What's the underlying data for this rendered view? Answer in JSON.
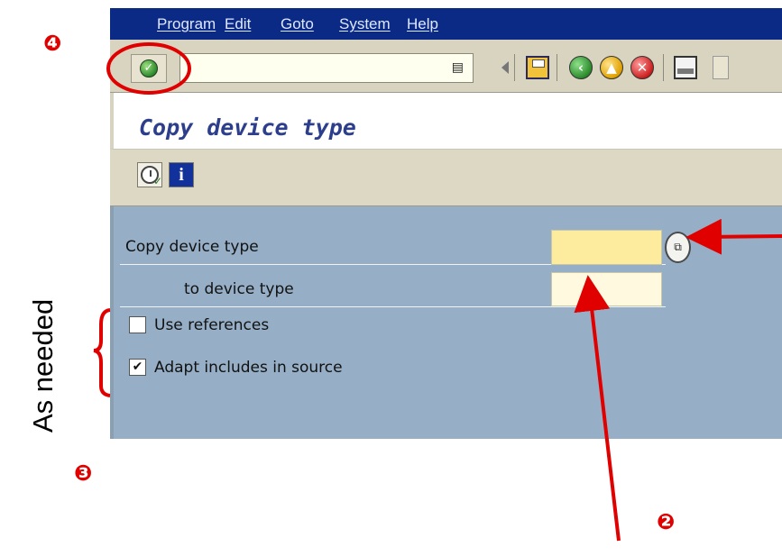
{
  "menu": {
    "items": [
      "Program",
      "Edit",
      "Goto",
      "System",
      "Help"
    ]
  },
  "toolbar": {
    "ok_icon": "green-check-icon",
    "command_field_value": "",
    "command_icon": "document-icon",
    "save_icon": "save-icon",
    "back_icon": "back-icon",
    "exit_icon": "exit-icon",
    "cancel_icon": "cancel-icon",
    "print_icon": "print-icon"
  },
  "title": "Copy device type",
  "app_toolbar": {
    "execute_icon": "clock-check-icon",
    "info_icon": "info-icon"
  },
  "form": {
    "copy_label": "Copy device type",
    "copy_value": "",
    "to_label": "to device type",
    "to_value": "",
    "use_references_label": "Use references",
    "use_references_checked": false,
    "adapt_includes_label": "Adapt includes in source",
    "adapt_includes_checked": true,
    "check_mark": "✔"
  },
  "annotations": {
    "step2": "❷",
    "step3": "❸",
    "step4": "❹",
    "side_text": "As needed",
    "color": "#e00000"
  }
}
